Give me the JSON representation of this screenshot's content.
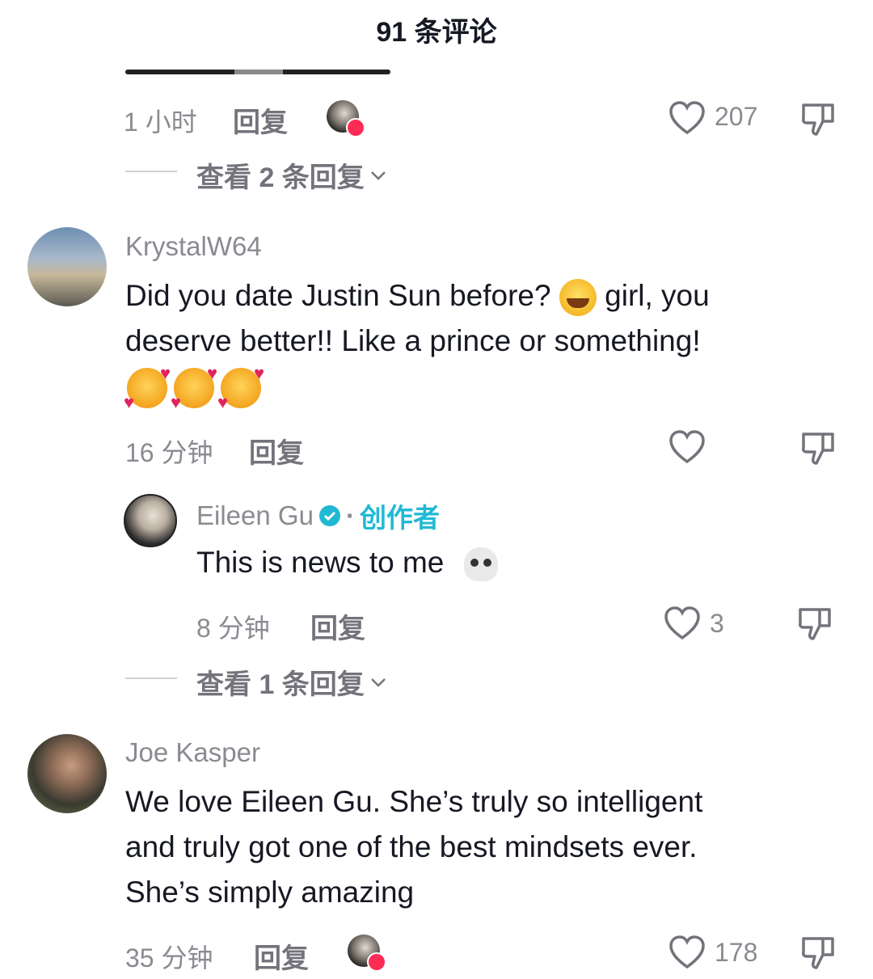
{
  "header": {
    "title": "91 条评论"
  },
  "top_comment": {
    "time": "1 小时",
    "reply_label": "回复",
    "likes": "207",
    "view_replies": "查看 2 条回复"
  },
  "comments": [
    {
      "username": "KrystalW64",
      "text_line1": "Did you date Justin Sun before?",
      "text_line1b": "girl, you",
      "text_line2": "deserve better!! Like a prince or something!",
      "time": "16 分钟",
      "reply_label": "回复",
      "likes": ""
    },
    {
      "username": "Eileen Gu",
      "separator": "·",
      "creator_label": "创作者",
      "text": "This is news to me",
      "time": "8 分钟",
      "reply_label": "回复",
      "likes": "3",
      "view_replies": "查看 1 条回复"
    },
    {
      "username": "Joe Kasper",
      "text_line1": "We love Eileen Gu. She’s truly so intelligent",
      "text_line2": "and truly got one of the best mindsets ever.",
      "text_line3": "She’s simply amazing",
      "time": "35 分钟",
      "reply_label": "回复",
      "likes": "178"
    }
  ],
  "icons": {
    "like": "heart-outline-icon",
    "dislike": "thumbs-down-icon",
    "verified": "verified-badge-icon",
    "chevron": "chevron-down-icon"
  },
  "colors": {
    "accent": "#20b9d5",
    "liked_heart": "#fe2c55"
  }
}
